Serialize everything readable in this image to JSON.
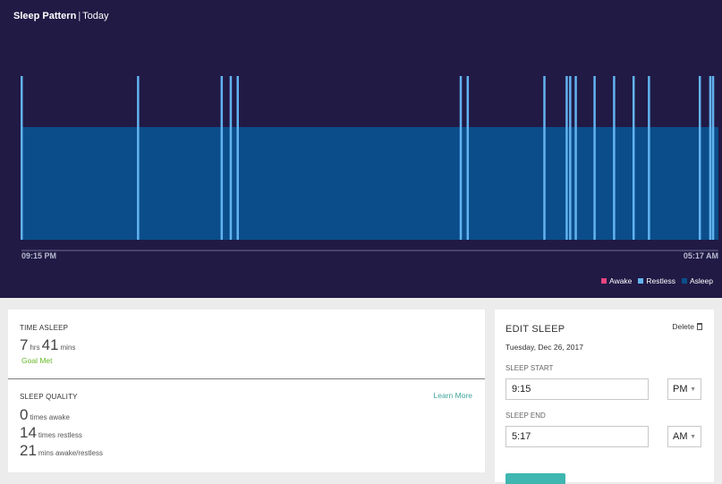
{
  "chart": {
    "title": "Sleep Pattern",
    "separator": "|",
    "period": "Today",
    "start_time": "09:15 PM",
    "end_time": "05:17 AM",
    "legend": [
      {
        "label": "Awake",
        "color": "#e8457f"
      },
      {
        "label": "Restless",
        "color": "#62b3f0"
      },
      {
        "label": "Asleep",
        "color": "#0b4d8a"
      }
    ]
  },
  "chart_data": {
    "type": "bar",
    "title": "Sleep Pattern",
    "xlabel": "",
    "ylabel": "",
    "x_range": [
      "09:15 PM",
      "05:17 AM"
    ],
    "baseline_state": "Asleep",
    "levels": {
      "Asleep": 1,
      "Restless": 2
    },
    "restless_events_fraction": [
      0.0,
      0.167,
      0.287,
      0.3,
      0.31,
      0.63,
      0.64,
      0.75,
      0.782,
      0.787,
      0.795,
      0.822,
      0.85,
      0.878,
      0.9,
      0.973,
      0.988,
      0.992
    ],
    "colors": {
      "Asleep": "#0b4d8a",
      "Restless": "#62b3f0",
      "Awake": "#e8457f"
    }
  },
  "stats": {
    "time_asleep_label": "TIME ASLEEP",
    "hours": "7",
    "hours_unit": "hrs",
    "minutes": "41",
    "minutes_unit": "mins",
    "goal_status": "Goal Met",
    "sleep_quality_label": "SLEEP QUALITY",
    "learn_more": "Learn More",
    "times_awake": "0",
    "times_awake_unit": "times awake",
    "times_restless": "14",
    "times_restless_unit": "times restless",
    "mins_awake_restless": "21",
    "mins_awake_restless_unit": "mins awake/restless"
  },
  "edit": {
    "title": "EDIT SLEEP",
    "delete_label": "Delete",
    "date": "Tuesday, Dec 26, 2017",
    "start_label": "SLEEP START",
    "start_value": "9:15",
    "start_ampm": "PM",
    "end_label": "SLEEP END",
    "end_value": "5:17",
    "end_ampm": "AM"
  }
}
